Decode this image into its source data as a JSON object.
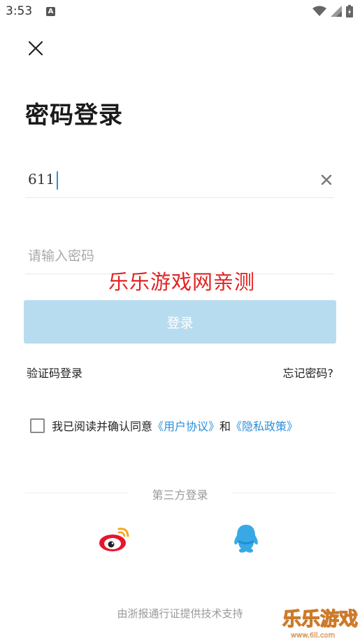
{
  "status_bar": {
    "time": "3:53",
    "notif_letter": "A"
  },
  "page": {
    "title": "密码登录"
  },
  "form": {
    "account_value": "611",
    "password_placeholder": "请输入密码",
    "login_label": "登录"
  },
  "watermark": {
    "text": "乐乐游戏网亲测",
    "logo_text": "乐乐游戏",
    "logo_url_text": "www.6ll.com"
  },
  "links": {
    "sms_login": "验证码登录",
    "forgot_password": "忘记密码?"
  },
  "agreement": {
    "prefix": "我已阅读并确认同意",
    "user_agreement": "《用户协议》",
    "and": "和",
    "privacy_policy": "《隐私政策》"
  },
  "third_party": {
    "title": "第三方登录"
  },
  "footer": {
    "note": "由浙报通行证提供技术支持"
  },
  "colors": {
    "accent": "#2b8fd9",
    "login_button": "#b8dcef",
    "watermark": "#e32222"
  },
  "icons": [
    "close-icon",
    "clear-icon",
    "weibo-icon",
    "qq-icon",
    "wifi-icon",
    "signal-icon",
    "battery-icon"
  ]
}
